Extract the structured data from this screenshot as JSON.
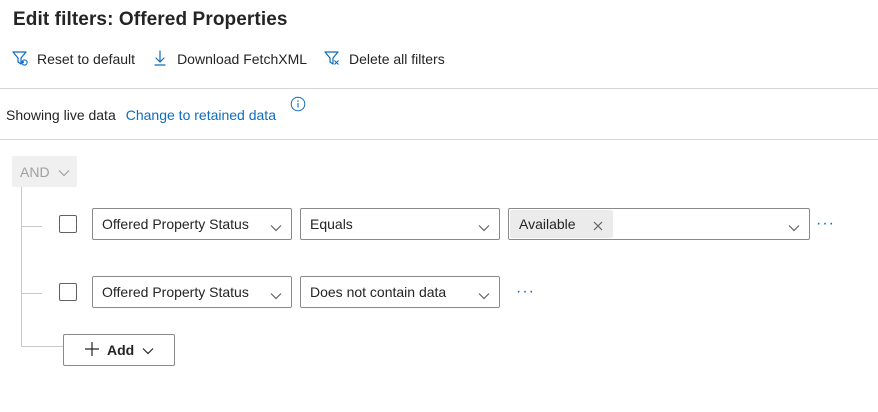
{
  "page": {
    "title": "Edit filters: Offered Properties"
  },
  "toolbar": {
    "reset_label": "Reset to default",
    "download_label": "Download FetchXML",
    "delete_label": "Delete all filters"
  },
  "data_source": {
    "status_text": "Showing live data",
    "change_link": "Change to retained data"
  },
  "group": {
    "operator": "AND"
  },
  "conditions": [
    {
      "field": "Offered Property Status",
      "operator": "Equals",
      "values": [
        "Available"
      ]
    },
    {
      "field": "Offered Property Status",
      "operator": "Does not contain data",
      "values": []
    }
  ],
  "add_button": {
    "label": "Add"
  },
  "icons": {
    "reset": "filter-reset-icon",
    "download": "download-icon",
    "delete": "filter-delete-icon",
    "info": "info-icon",
    "more": "more-options-icon"
  },
  "colors": {
    "accent": "#0f6cbd",
    "text": "#242424",
    "tag_bg": "#ebebeb"
  }
}
